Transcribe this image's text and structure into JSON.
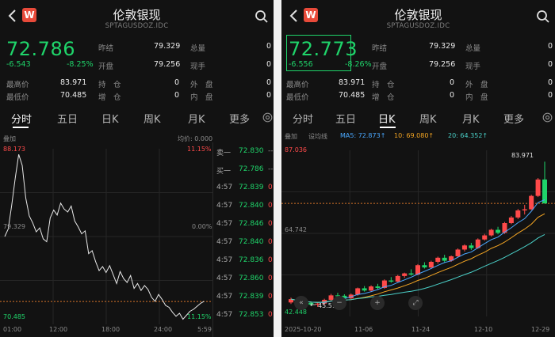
{
  "common": {
    "title": "伦敦银现",
    "subtitle": "SPTAGUSDOZ.IDC",
    "logo_text": "W",
    "labels": {
      "prev_close": "昨结",
      "volume": "总量",
      "open": "开盘",
      "current_vol": "现手",
      "high": "最高价",
      "low": "最低价",
      "hold": "持　仓",
      "outer": "外　盘",
      "add": "增　仓",
      "inner": "内　盘"
    },
    "tabs": [
      "分时",
      "五日",
      "日K",
      "周K",
      "月K",
      "更多"
    ]
  },
  "left": {
    "price": "72.786",
    "change": "-6.543",
    "change_pct": "-8.25%",
    "prev_close": "79.329",
    "volume": "0",
    "open": "79.256",
    "current_vol": "0",
    "high": "83.971",
    "hold": "0",
    "outer": "0",
    "low": "70.485",
    "add": "0",
    "inner": "0",
    "active_tab": 0,
    "chart_header_left": "叠加",
    "chart_header_right": "均价: 0.000",
    "y_top": "88.173",
    "y_top_pct": "11.15%",
    "y_mid": "79.329",
    "y_mid_pct": "0.00%",
    "y_bottom": "70.485",
    "y_bottom_pct": "11.15%",
    "x_labels": [
      "01:00",
      "12:00",
      "18:00",
      "24:00",
      "5:59"
    ],
    "book": [
      {
        "label": "卖一",
        "price": "72.830",
        "vol": "--"
      },
      {
        "label": "买一",
        "price": "72.786",
        "vol": "--"
      },
      {
        "label": "4:57",
        "price": "72.839",
        "vol": "0"
      },
      {
        "label": "4:57",
        "price": "72.840",
        "vol": "0"
      },
      {
        "label": "4:57",
        "price": "72.846",
        "vol": "0"
      },
      {
        "label": "4:57",
        "price": "72.840",
        "vol": "0"
      },
      {
        "label": "4:57",
        "price": "72.836",
        "vol": "0"
      },
      {
        "label": "4:57",
        "price": "72.860",
        "vol": "0"
      },
      {
        "label": "4:57",
        "price": "72.839",
        "vol": "0"
      },
      {
        "label": "4:57",
        "price": "72.853",
        "vol": "0"
      }
    ]
  },
  "right": {
    "price": "72.773",
    "change": "-6.556",
    "change_pct": "-8.26%",
    "prev_close": "79.329",
    "volume": "0",
    "open": "79.256",
    "current_vol": "0",
    "high": "83.971",
    "hold": "0",
    "outer": "0",
    "low": "70.485",
    "add": "0",
    "inner": "0",
    "active_tab": 2,
    "overlay_label": "叠加",
    "settings_label": "设均线",
    "ma5": "MA5: 72.873↑",
    "ma10": "10: 69.080↑",
    "ma20": "20: 64.352↑",
    "y_top": "87.036",
    "y_mid": "64.742",
    "y_bottom": "42.448",
    "max_label": "83.971",
    "min_label": "45.513",
    "x_labels": [
      "2025-10-20",
      "11-06",
      "11-24",
      "12-10",
      "12-29"
    ]
  },
  "chart_data": [
    {
      "type": "line",
      "title": "",
      "series": [
        {
          "values": [
            79.33,
            80.1,
            82.5,
            85.2,
            87.6,
            86.5,
            83.2,
            81.4,
            80.7,
            79.8,
            80.2,
            79.1,
            78.8,
            81.2,
            82.0,
            81.5,
            82.7,
            82.1,
            81.8,
            82.4,
            80.9,
            80.3,
            79.6,
            79.9,
            77.6,
            77.9,
            76.8,
            75.9,
            76.3,
            75.7,
            76.4,
            75.5,
            74.6,
            75.8,
            75.1,
            74.7,
            75.4,
            74.1,
            74.6,
            73.9,
            74.4,
            74.0,
            73.2,
            72.8,
            73.5,
            73.0,
            72.4,
            72.2,
            71.7,
            71.3,
            71.6,
            71.0,
            71.4,
            71.8,
            72.0,
            72.3,
            72.6,
            72.8
          ]
        }
      ],
      "ylim": [
        70.485,
        88.173
      ],
      "x_tick_labels": [
        "01:00",
        "12:00",
        "18:00",
        "24:00",
        "5:59"
      ]
    },
    {
      "type": "candlestick",
      "title": "",
      "series": [
        {
          "name": "K",
          "ohlc": [
            [
              46.2,
              47.5,
              45.8,
              47.1
            ],
            [
              47.1,
              47.4,
              46.0,
              46.4
            ],
            [
              46.4,
              46.9,
              45.5,
              46.1
            ],
            [
              46.1,
              46.5,
              45.2,
              45.6
            ],
            [
              45.6,
              46.2,
              45.0,
              45.9
            ],
            [
              45.9,
              47.2,
              45.6,
              46.9
            ],
            [
              46.9,
              48.5,
              46.5,
              48.1
            ],
            [
              48.1,
              48.8,
              47.6,
              48.0
            ],
            [
              48.0,
              48.4,
              47.0,
              47.3
            ],
            [
              47.3,
              48.6,
              47.1,
              48.3
            ],
            [
              48.3,
              50.2,
              48.0,
              50.0
            ],
            [
              50.0,
              50.6,
              49.1,
              49.4
            ],
            [
              49.4,
              50.8,
              49.0,
              50.5
            ],
            [
              50.5,
              51.2,
              49.8,
              50.1
            ],
            [
              50.1,
              52.4,
              49.9,
              52.1
            ],
            [
              52.1,
              53.0,
              51.5,
              51.8
            ],
            [
              51.8,
              53.6,
              51.6,
              53.3
            ],
            [
              53.3,
              54.2,
              52.8,
              54.0
            ],
            [
              54.0,
              55.1,
              53.4,
              53.7
            ],
            [
              53.7,
              56.5,
              53.5,
              56.2
            ],
            [
              56.2,
              57.0,
              55.3,
              55.6
            ],
            [
              55.6,
              57.4,
              55.2,
              57.1
            ],
            [
              57.1,
              58.5,
              56.6,
              58.2
            ],
            [
              58.2,
              59.0,
              57.0,
              57.4
            ],
            [
              57.4,
              58.8,
              57.1,
              58.6
            ],
            [
              58.6,
              60.7,
              58.4,
              60.4
            ],
            [
              60.4,
              61.8,
              59.9,
              61.5
            ],
            [
              61.5,
              62.2,
              60.3,
              60.8
            ],
            [
              60.8,
              63.4,
              60.6,
              63.1
            ],
            [
              63.1,
              64.6,
              62.8,
              64.2
            ],
            [
              64.2,
              66.0,
              63.9,
              65.7
            ],
            [
              65.7,
              66.5,
              64.5,
              64.9
            ],
            [
              64.9,
              67.8,
              64.6,
              67.5
            ],
            [
              67.5,
              69.4,
              67.2,
              69.0
            ],
            [
              69.0,
              71.3,
              68.6,
              70.9
            ],
            [
              70.9,
              72.4,
              69.8,
              71.2
            ],
            [
              71.2,
              75.1,
              71.0,
              74.8
            ],
            [
              74.8,
              79.6,
              74.5,
              79.2
            ],
            [
              79.2,
              83.971,
              77.8,
              72.77
            ]
          ]
        },
        {
          "name": "MA5",
          "values": [
            72.873
          ]
        },
        {
          "name": "10",
          "values": [
            69.08
          ]
        },
        {
          "name": "20",
          "values": [
            64.352
          ]
        }
      ],
      "ylim": [
        42.448,
        87.036
      ],
      "x_tick_labels": [
        "2025-10-20",
        "11-06",
        "11-24",
        "12-10",
        "12-29"
      ]
    }
  ]
}
